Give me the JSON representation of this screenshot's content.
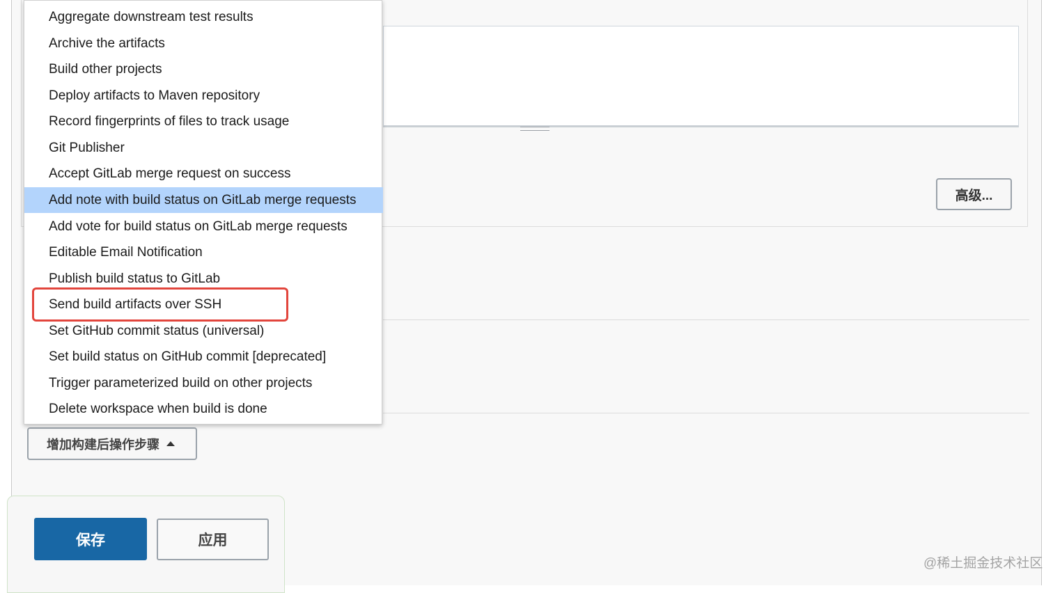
{
  "menu": {
    "items": [
      "Aggregate downstream test results",
      "Archive the artifacts",
      "Build other projects",
      "Deploy artifacts to Maven repository",
      "Record fingerprints of files to track usage",
      "Git Publisher",
      "Accept GitLab merge request on success",
      "Add note with build status on GitLab merge requests",
      "Add vote for build status on GitLab merge requests",
      "Editable Email Notification",
      "Publish build status to GitLab",
      "Send build artifacts over SSH",
      "Set GitHub commit status (universal)",
      "Set build status on GitHub commit [deprecated]",
      "Trigger parameterized build on other projects",
      "Delete workspace when build is done"
    ],
    "selected_index": 7,
    "highlighted_index": 11
  },
  "config": {
    "advanced_label": "高级..."
  },
  "post_build": {
    "add_step_label": "增加构建后操作步骤"
  },
  "actions": {
    "save_label": "保存",
    "apply_label": "应用"
  },
  "watermark": "@稀土掘金技术社区",
  "colors": {
    "selected_bg": "#b3d4fc",
    "save_bg": "#1867a5",
    "highlight_border": "#e2453c"
  }
}
